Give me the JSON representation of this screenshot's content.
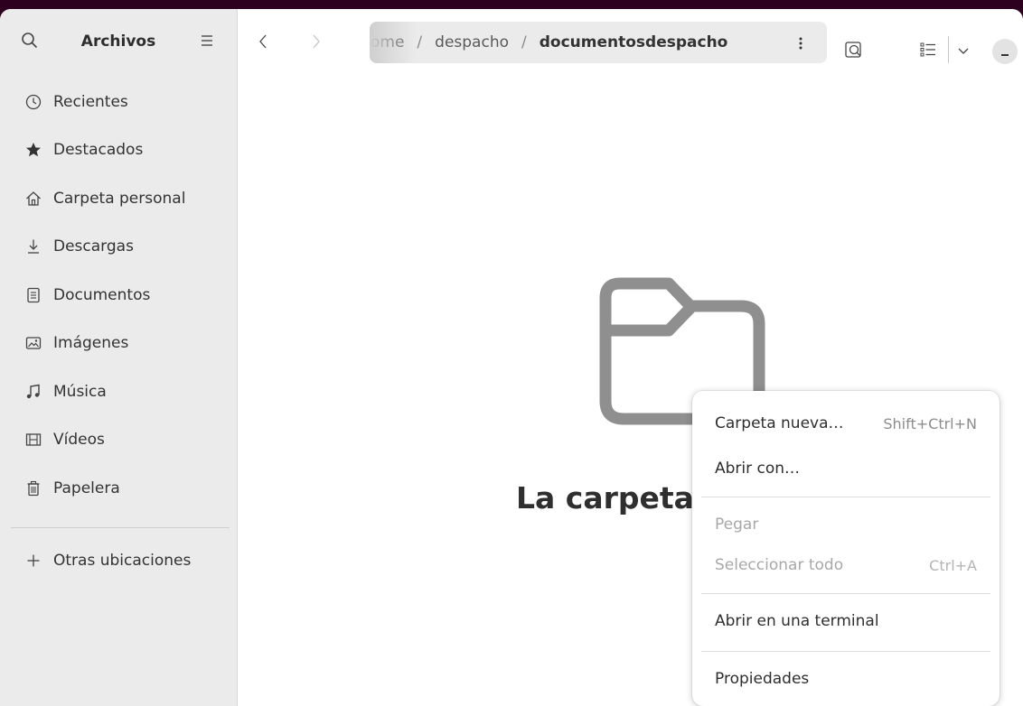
{
  "app": {
    "title": "Archivos"
  },
  "sidebar": {
    "items": [
      {
        "label": "Recientes",
        "icon": "clock-icon"
      },
      {
        "label": "Destacados",
        "icon": "star-icon"
      },
      {
        "label": "Carpeta personal",
        "icon": "home-icon"
      },
      {
        "label": "Descargas",
        "icon": "download-icon"
      },
      {
        "label": "Documentos",
        "icon": "document-icon"
      },
      {
        "label": "Imágenes",
        "icon": "image-icon"
      },
      {
        "label": "Música",
        "icon": "music-icon"
      },
      {
        "label": "Vídeos",
        "icon": "video-icon"
      },
      {
        "label": "Papelera",
        "icon": "trash-icon"
      }
    ],
    "other_locations": {
      "label": "Otras ubicaciones",
      "icon": "plus-icon"
    }
  },
  "pathbar": {
    "segments": [
      "ome",
      "despacho",
      "documentosdespacho"
    ],
    "separator": "/",
    "menu_glyph": "⋮"
  },
  "content": {
    "empty_text": "La carpeta"
  },
  "context_menu": {
    "items": [
      {
        "label": "Carpeta nueva…",
        "accel": "Shift+Ctrl+N",
        "enabled": true
      },
      {
        "label": "Abrir con…",
        "accel": "",
        "enabled": true
      },
      {
        "label": "Pegar",
        "accel": "",
        "enabled": false
      },
      {
        "label": "Seleccionar todo",
        "accel": "Ctrl+A",
        "enabled": false
      },
      {
        "label": "Abrir en una terminal",
        "accel": "",
        "enabled": true
      },
      {
        "label": "Propiedades",
        "accel": "",
        "enabled": true
      }
    ]
  },
  "colors": {
    "titlebar_background": "#2c001e",
    "sidebar_background": "#ebebeb",
    "folder_icon": "#8f8f8f"
  }
}
